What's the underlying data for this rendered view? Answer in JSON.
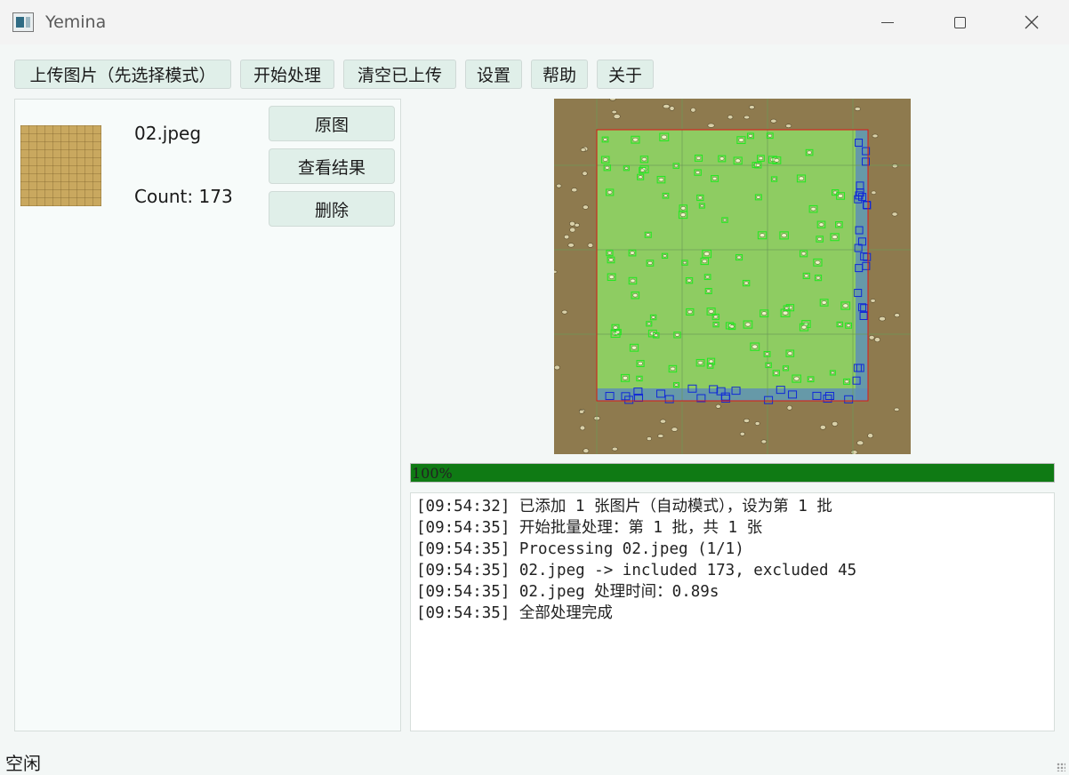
{
  "window": {
    "title": "Yemina",
    "minimize_label": "—",
    "maximize_label": "□",
    "close_label": "✕"
  },
  "toolbar": {
    "upload_label": "上传图片（先选择模式）",
    "start_label": "开始处理",
    "clear_label": "清空已上传",
    "settings_label": "设置",
    "help_label": "帮助",
    "about_label": "关于"
  },
  "file_item": {
    "name": "02.jpeg",
    "count_label": "Count: 173",
    "original_label": "原图",
    "result_label": "查看结果",
    "delete_label": "删除"
  },
  "progress": {
    "value": 100,
    "label": "100%",
    "color": "#0f7a14"
  },
  "log": [
    "[09:54:32] 已添加 1 张图片（自动模式），设为第 1 批",
    "[09:54:35] 开始批量处理：第 1 批，共 1 张",
    "[09:54:35] Processing 02.jpeg (1/1)",
    "[09:54:35] 02.jpeg -> included 173, excluded 45",
    "[09:54:35] 02.jpeg 处理时间：0.89s",
    "[09:54:35] 全部处理完成"
  ],
  "status": {
    "text": "空闲"
  },
  "colors": {
    "included_box": "#22e822",
    "excluded_box": "#1028d8",
    "roi_border": "#e01515",
    "roi_fill": "#8ee86a",
    "excluded_band": "#5f8fb5",
    "image_bg": "#8e7a4e"
  }
}
